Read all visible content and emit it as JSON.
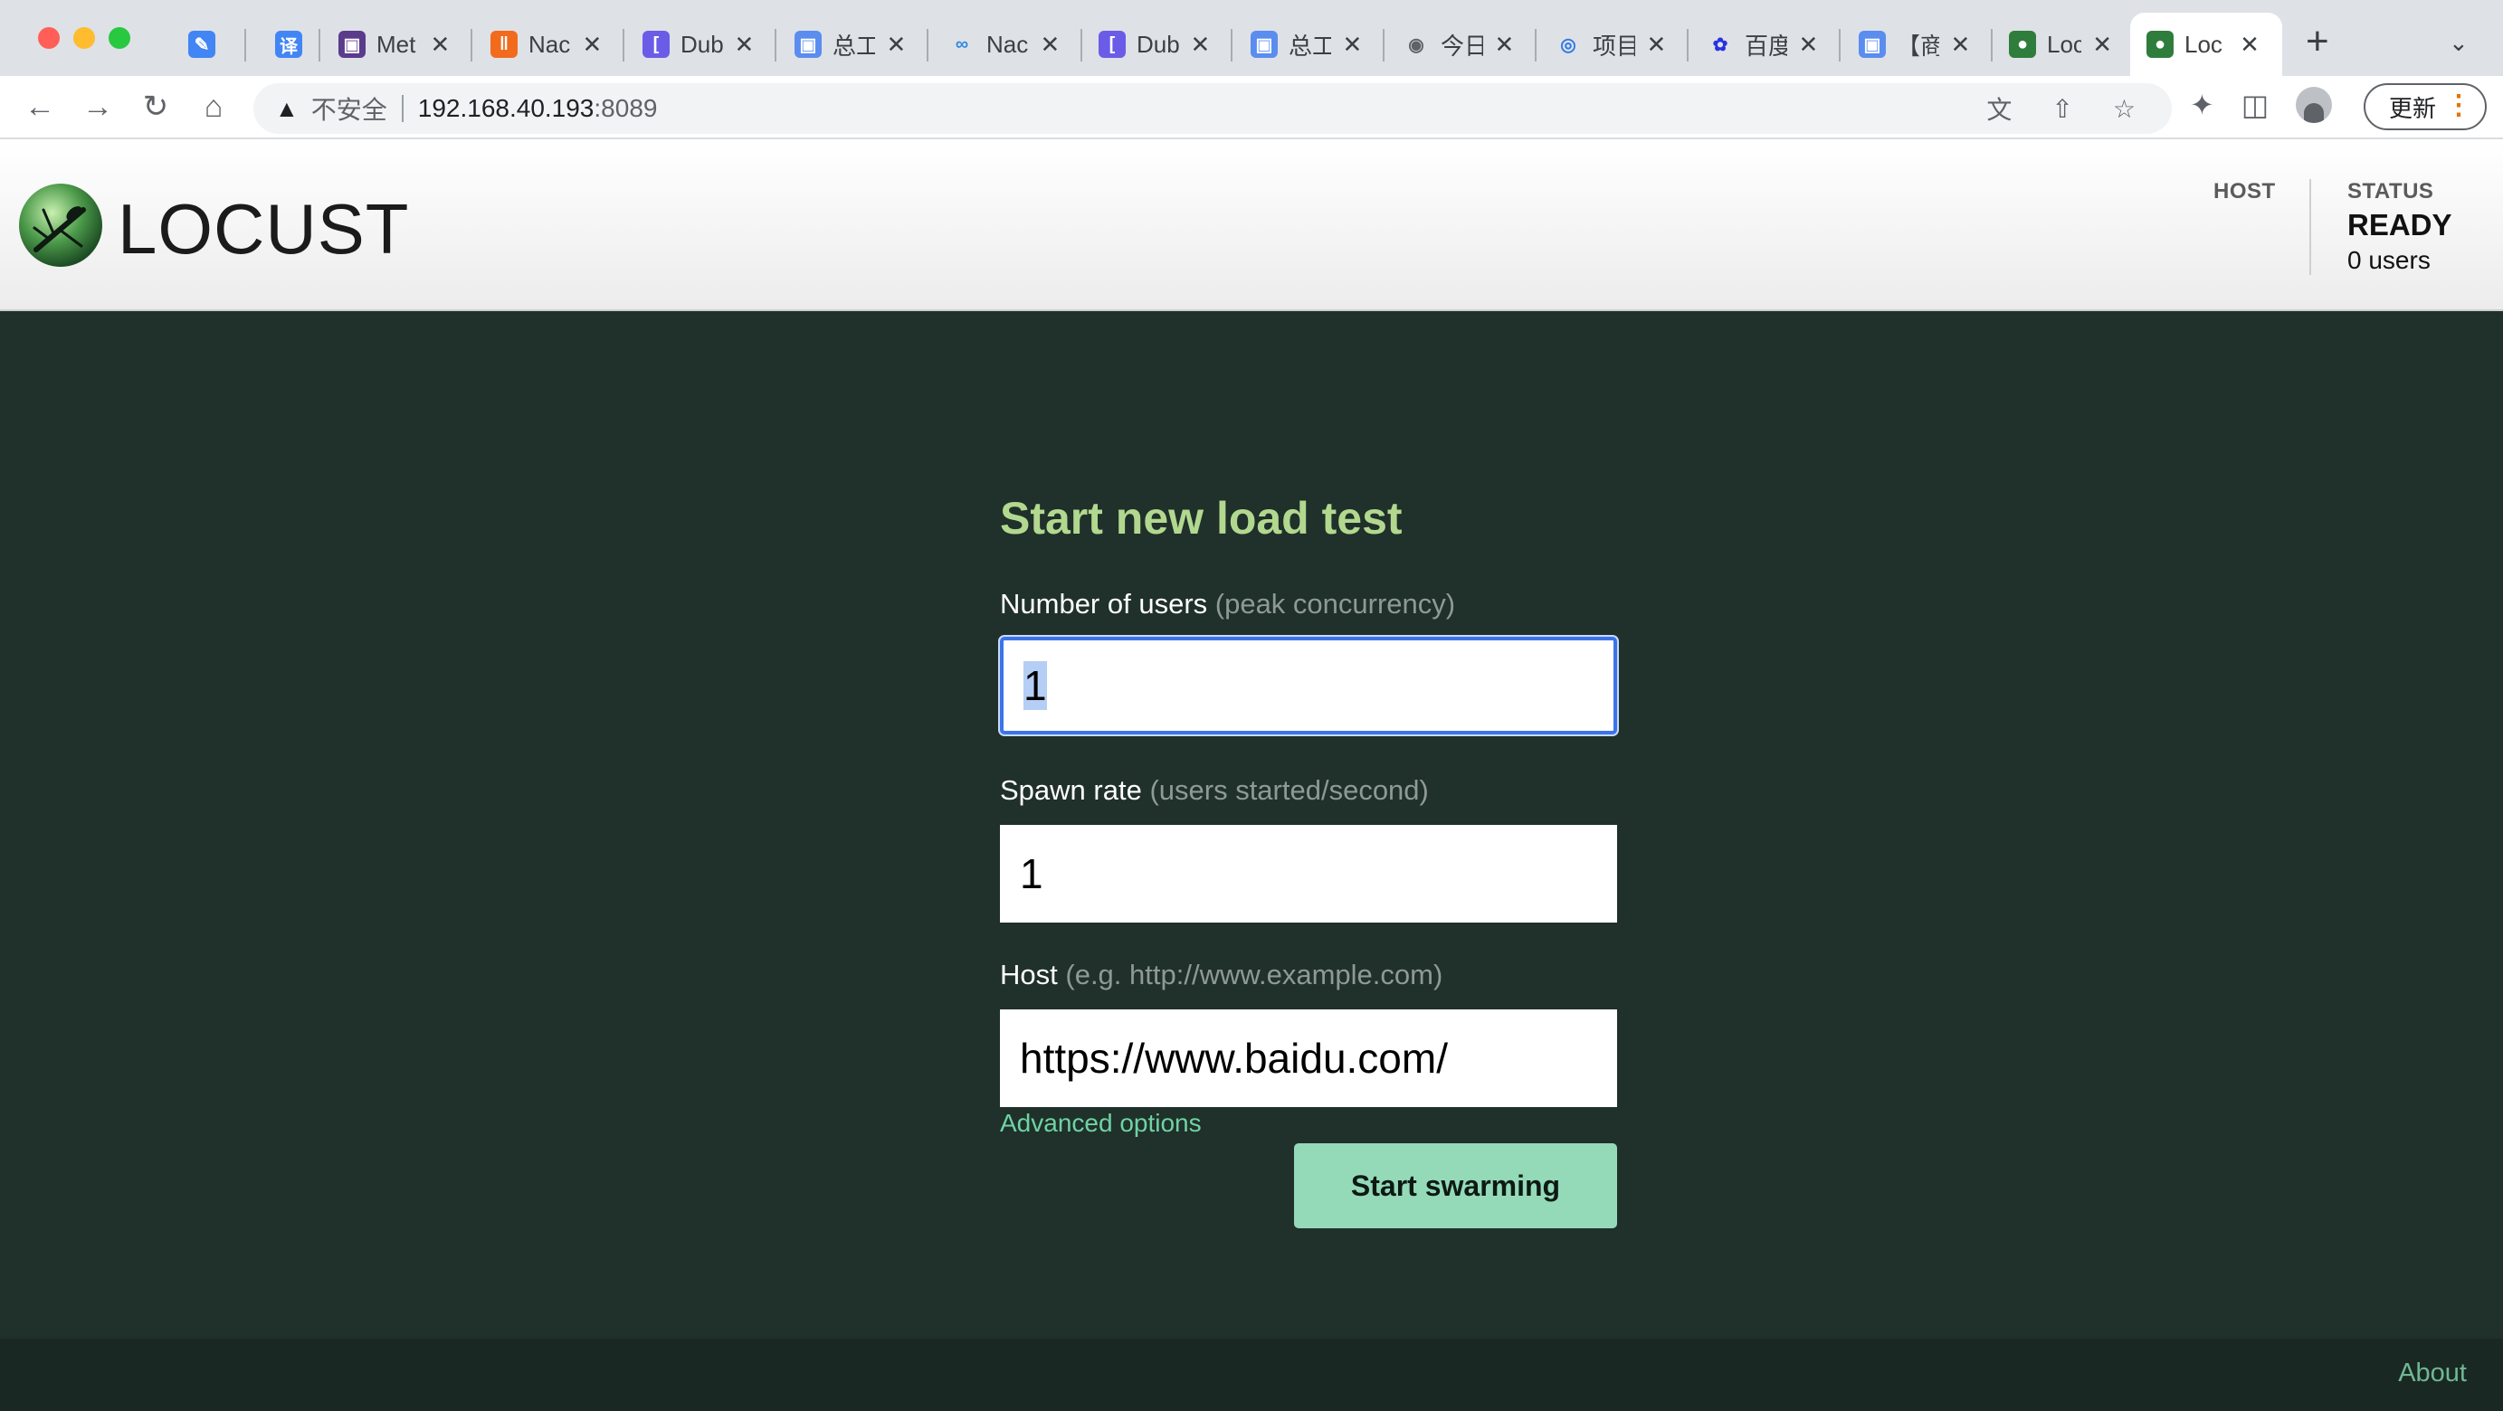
{
  "browser": {
    "tabs": [
      {
        "title": "",
        "icon": "pen-icon",
        "color": "#4285f4"
      },
      {
        "title": "",
        "icon": "translate-icon",
        "color": "#4285f4",
        "glyph": "译"
      },
      {
        "title": "Met",
        "icon": "cube-icon",
        "color": "#5a3b8c"
      },
      {
        "title": "Nac",
        "icon": "alibaba-icon",
        "color": "#f26b1d"
      },
      {
        "title": "Dub",
        "icon": "bracket-icon",
        "color": "#6b5ce7"
      },
      {
        "title": "总工",
        "icon": "box-icon",
        "color": "#5b8def"
      },
      {
        "title": "Nac",
        "icon": "infinity-icon",
        "color": "#2f8be0"
      },
      {
        "title": "Dub",
        "icon": "bracket-icon",
        "color": "#6b5ce7"
      },
      {
        "title": "总工",
        "icon": "box-icon",
        "color": "#5b8def"
      },
      {
        "title": "今日",
        "icon": "globe-icon",
        "color": "#5f6368"
      },
      {
        "title": "项目",
        "icon": "spiral-icon",
        "color": "#2f7be5"
      },
      {
        "title": "百度",
        "icon": "paw-icon",
        "color": "#2932e1"
      },
      {
        "title": "【商",
        "icon": "box-icon",
        "color": "#5b8def"
      },
      {
        "title": "Loc",
        "icon": "locust-icon",
        "color": "#2f7d3c"
      },
      {
        "title": "Loc",
        "icon": "locust-icon",
        "color": "#2f7d3c",
        "active": true
      }
    ],
    "url_insecure_label": "不安全",
    "url_host": "192.168.40.193",
    "url_port": ":8089",
    "update_label": "更新"
  },
  "header": {
    "logo_text": "LOCUST",
    "host_label": "HOST",
    "status_label": "STATUS",
    "status_value": "READY",
    "user_count": "0 users"
  },
  "form": {
    "title": "Start new load test",
    "users_label": "Number of users",
    "users_hint": "(peak concurrency)",
    "users_value": "1",
    "rate_label": "Spawn rate",
    "rate_hint": "(users started/second)",
    "rate_value": "1",
    "host_label": "Host",
    "host_hint": "(e.g. http://www.example.com)",
    "host_value": "https://www.baidu.com/",
    "advanced_label": "Advanced options",
    "submit_label": "Start swarming"
  },
  "footer": {
    "about_label": "About"
  }
}
